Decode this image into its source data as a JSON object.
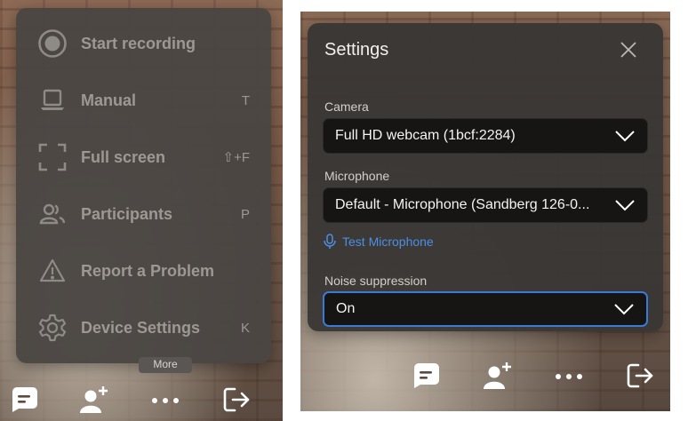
{
  "more_menu": {
    "items": [
      {
        "label": "Start recording",
        "shortcut": "",
        "icon": "record-icon"
      },
      {
        "label": "Manual",
        "shortcut": "T",
        "icon": "laptop-icon"
      },
      {
        "label": "Full screen",
        "shortcut": "⇧+F",
        "icon": "fullscreen-icon"
      },
      {
        "label": "Participants",
        "shortcut": "P",
        "icon": "participants-icon"
      },
      {
        "label": "Report a Problem",
        "shortcut": "",
        "icon": "warning-icon"
      },
      {
        "label": "Device Settings",
        "shortcut": "K",
        "icon": "gear-icon"
      }
    ],
    "tooltip": "More"
  },
  "toolbar": {
    "buttons": [
      "chat-icon",
      "add-participant-icon",
      "more-icon",
      "leave-icon"
    ]
  },
  "settings": {
    "title": "Settings",
    "camera": {
      "label": "Camera",
      "value": "Full HD webcam (1bcf:2284)"
    },
    "microphone": {
      "label": "Microphone",
      "value": "Default - Microphone (Sandberg 126-0..."
    },
    "test_microphone": "Test Microphone",
    "noise_suppression": {
      "label": "Noise suppression",
      "value": "On"
    }
  },
  "colors": {
    "accent": "#3a7bd5",
    "link": "#4b8fe6",
    "menu_bg": "#4a4643",
    "dialog_bg": "#3a3735"
  }
}
